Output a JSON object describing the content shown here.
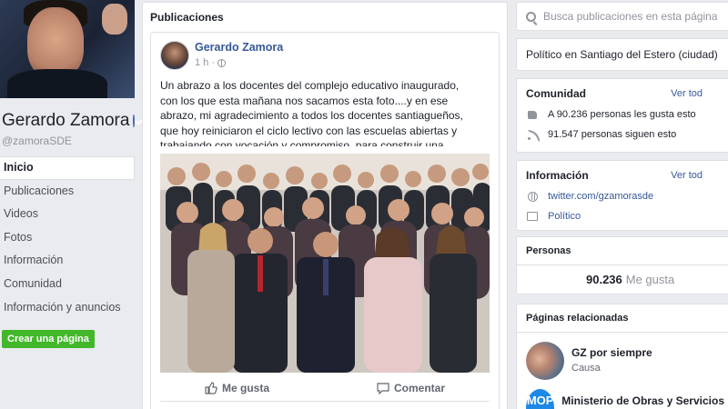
{
  "page": {
    "name": "Gerardo Zamora",
    "handle": "@zamoraSDE"
  },
  "nav": {
    "items": [
      {
        "label": "Inicio",
        "active": true
      },
      {
        "label": "Publicaciones"
      },
      {
        "label": "Videos"
      },
      {
        "label": "Fotos"
      },
      {
        "label": "Información"
      },
      {
        "label": "Comunidad"
      },
      {
        "label": "Información y anuncios"
      }
    ],
    "create_page": "Crear una página"
  },
  "feed": {
    "title": "Publicaciones",
    "post": {
      "author": "Gerardo Zamora",
      "time": "1 h ·",
      "text": "Un abrazo a los docentes del complejo educativo inaugurado, con los que esta mañana nos sacamos esta foto....y en ese abrazo, mi agradecimiento a todos los docentes santiagueños, que hoy reiniciaron el ciclo lectivo con las escuelas abiertas y trabajando con vocación y compromiso, para construir una provincia con mejor futuro!!!",
      "like_label": "Me gusta",
      "comment_label": "Comentar"
    }
  },
  "sidebar": {
    "search_placeholder": "Busca publicaciones en esta página",
    "category": "Político en Santiago del Estero (ciudad)",
    "community": {
      "title": "Comunidad",
      "see_all": "Ver tod",
      "likes": "A 90.236 personas les gusta esto",
      "follows": "91.547 personas siguen esto"
    },
    "info": {
      "title": "Información",
      "see_all": "Ver tod",
      "twitter": "twitter.com/gzamorasde",
      "category": "Político"
    },
    "people": {
      "title": "Personas",
      "count": "90.236",
      "count_label": "Me gusta"
    },
    "related": {
      "title": "Páginas relacionadas",
      "items": [
        {
          "name": "GZ por siempre",
          "subtitle": "Causa"
        },
        {
          "name": "Ministerio de Obras y Servicios",
          "logo_text": "MOP"
        }
      ]
    }
  },
  "colors": {
    "background": "#e9ebee",
    "link": "#365899",
    "create_button": "#42b72a",
    "verified": "#4267b2"
  }
}
